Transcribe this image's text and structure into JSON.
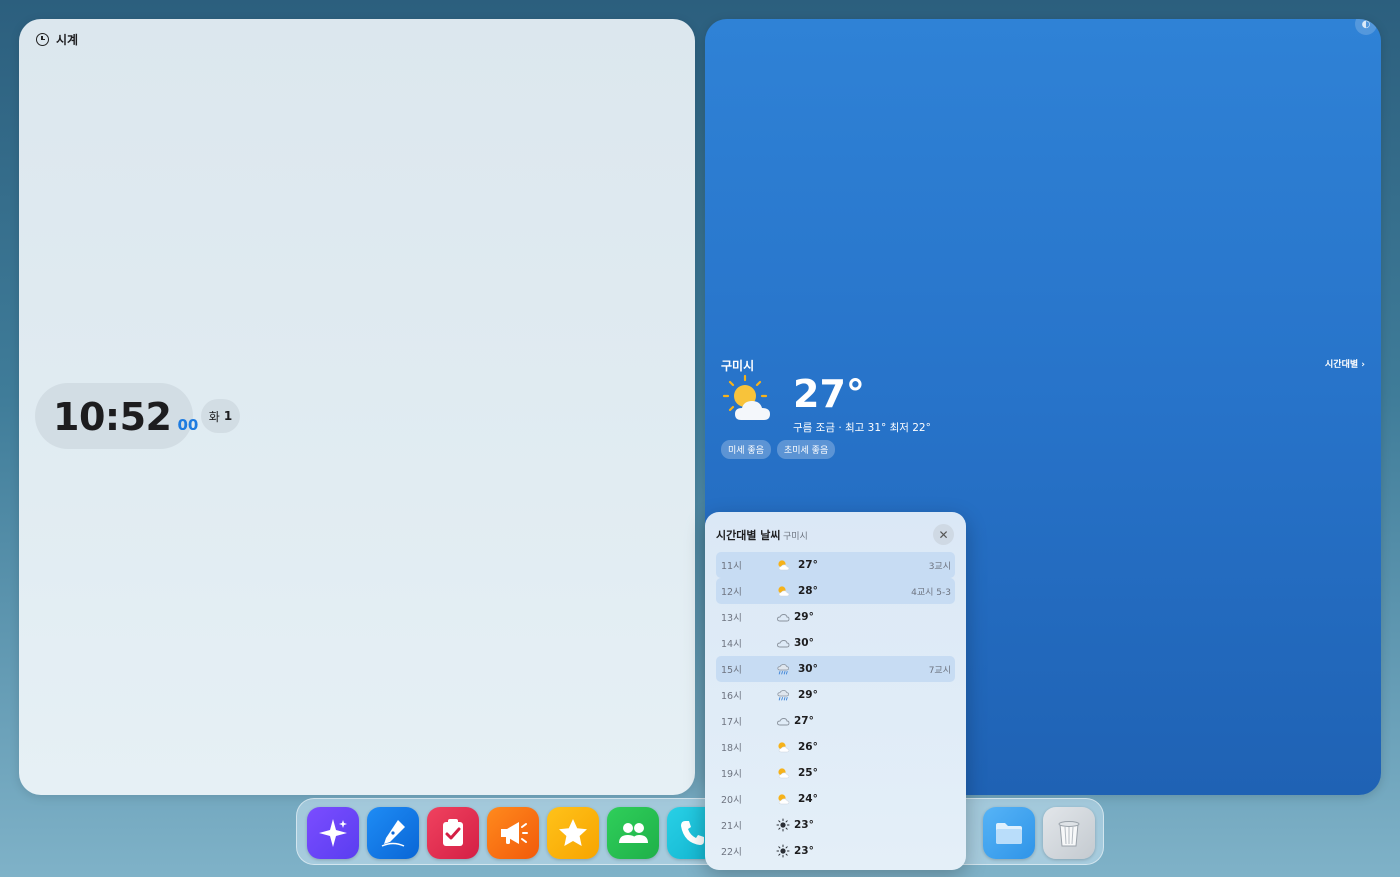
{
  "clock": {
    "title": "시계",
    "time": "10:52",
    "seconds": "00",
    "weekday": "화",
    "day": "1"
  },
  "weather": {
    "city": "구미시",
    "hourly_link": "시간대별 ›",
    "temperature": "27°",
    "condition_line": "구름 조금 · 최고 31° 최저 22°",
    "chips": [
      "미세 좋음",
      "초미세 좋음"
    ]
  },
  "hourly_popup": {
    "title": "시간대별 날씨",
    "subtitle": "구미시",
    "rows": [
      {
        "time": "11시",
        "icon": "partly-sunny",
        "temp": "27°",
        "note": "3교시",
        "highlight": true
      },
      {
        "time": "12시",
        "icon": "partly-sunny",
        "temp": "28°",
        "note": "4교시 5-3",
        "highlight": true
      },
      {
        "time": "13시",
        "icon": "cloud",
        "temp": "29°",
        "note": "",
        "highlight": false
      },
      {
        "time": "14시",
        "icon": "cloud",
        "temp": "30°",
        "note": "",
        "highlight": false
      },
      {
        "time": "15시",
        "icon": "rain",
        "temp": "30°",
        "note": "7교시",
        "highlight": true
      },
      {
        "time": "16시",
        "icon": "rain",
        "temp": "29°",
        "note": "",
        "highlight": false
      },
      {
        "time": "17시",
        "icon": "cloud",
        "temp": "27°",
        "note": "",
        "highlight": false
      },
      {
        "time": "18시",
        "icon": "partly-sunny",
        "temp": "26°",
        "note": "",
        "highlight": false
      },
      {
        "time": "19시",
        "icon": "partly-sunny",
        "temp": "25°",
        "note": "",
        "highlight": false
      },
      {
        "time": "20시",
        "icon": "partly-sunny",
        "temp": "24°",
        "note": "",
        "highlight": false
      },
      {
        "time": "21시",
        "icon": "sun",
        "temp": "23°",
        "note": "",
        "highlight": false
      },
      {
        "time": "22시",
        "icon": "sun",
        "temp": "23°",
        "note": "",
        "highlight": false
      }
    ]
  },
  "dock": {
    "apps": [
      "sparkle-app",
      "pen-app",
      "checklist-app",
      "megaphone-app",
      "star-app",
      "people-app",
      "phone-app",
      "folder-app",
      "trash-app"
    ]
  },
  "colors": {
    "accent_blue": "#1d7be0",
    "weather_panel": "#2773c9",
    "highlight_row": "#c7dcf3"
  }
}
